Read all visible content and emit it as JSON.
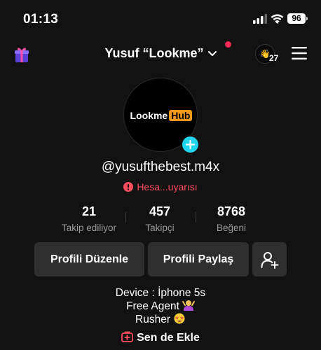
{
  "status_bar": {
    "time": "01:13",
    "battery": "96",
    "icons": [
      "signal-icon",
      "wifi-icon",
      "battery-icon"
    ]
  },
  "header": {
    "title": "Yusuf “Lookme”",
    "visitor_count": "27",
    "visitor_avatar_glyph": "👋",
    "icons": [
      "gift-icon",
      "chevron-down-icon",
      "menu-icon"
    ]
  },
  "profile": {
    "avatar_logo_text_a": "Lookme",
    "avatar_logo_text_b": "Hub",
    "handle": "@yusufthebest.m4x",
    "warning": "Hesa...uyarısı"
  },
  "stats": [
    {
      "value": "21",
      "label": "Takip ediliyor"
    },
    {
      "value": "457",
      "label": "Takipçi"
    },
    {
      "value": "8768",
      "label": "Beğeni"
    }
  ],
  "buttons": {
    "edit": "Profili Düzenle",
    "share": "Profili Paylaş"
  },
  "bio": {
    "line1": "Device : İphone 5s",
    "line2": "Free Agent",
    "line3": "Rusher",
    "add_label": "Sen de Ekle"
  },
  "colors": {
    "background": "#121212",
    "button": "#2f2f2f",
    "accent_red": "#fe2c55",
    "accent_cyan": "#20d5ec",
    "logo_orange": "#f7971d"
  }
}
